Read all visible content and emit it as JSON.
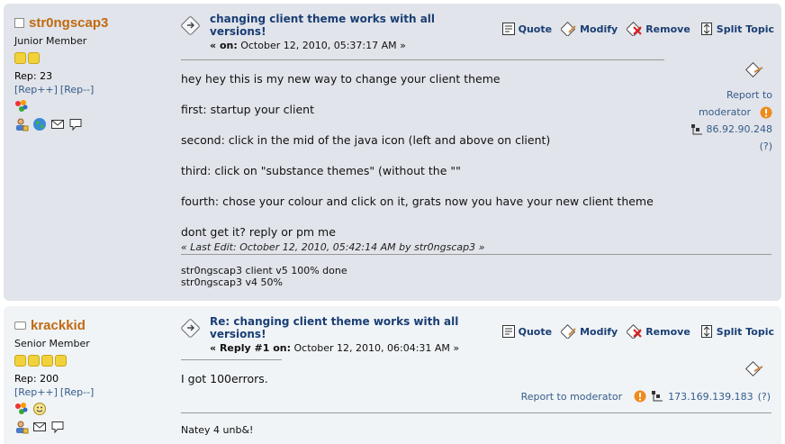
{
  "post1": {
    "username": "str0ngscap3",
    "rank": "Junior Member",
    "stars": 2,
    "rep": "Rep: 23",
    "rep_plus": "[Rep++]",
    "rep_minus": "[Rep--]",
    "title_line1": "changing client theme works with all",
    "title_line2": "versions!",
    "date_prefix": "« ",
    "date_on": "on:",
    "date_value": " October 12, 2010, 05:37:17 AM »",
    "body": [
      "hey hey this is my new way to change your client theme",
      "first: startup your client",
      "second: click in the mid of the java icon (left and above on client)",
      "third: click on \"substance themes\" (without the \"\"",
      "fourth: chose your colour and click on it, grats now you have your new client theme",
      "dont get it? reply or pm me"
    ],
    "last_edit": "« Last Edit: October 12, 2010, 05:42:14 AM by str0ngscap3 »",
    "sig_line1": "str0ngscap3 client v5 100% done",
    "sig_line2": "str0ngscap3 v4 50%",
    "report_line1": "Report to",
    "report_line2": "moderator",
    "ip": "86.92.90.248",
    "ip_q": "(?)"
  },
  "post2": {
    "username": "krackkid",
    "rank": "Senior Member",
    "stars": 4,
    "rep": "Rep: 200",
    "rep_plus": "[Rep++]",
    "rep_minus": "[Rep--]",
    "title_line1": "Re: changing client theme works with all",
    "title_line2": "versions!",
    "date_prefix": "« ",
    "date_reply": "Reply #1 on:",
    "date_value": " October 12, 2010, 06:04:31 AM »",
    "body": "I got 100errors.",
    "report": "Report to moderator",
    "ip": "173.169.139.183",
    "ip_q": "(?)",
    "sig_line1": "Natey 4 unb&!"
  },
  "tools": {
    "quote": "Quote",
    "modify": "Modify",
    "remove": "Remove",
    "split": "Split Topic"
  },
  "colors": {
    "username": "#c06a12",
    "link": "#1a3e74",
    "post1_bg": "#e1e4ea",
    "post2_bg": "#f0f4f7"
  }
}
